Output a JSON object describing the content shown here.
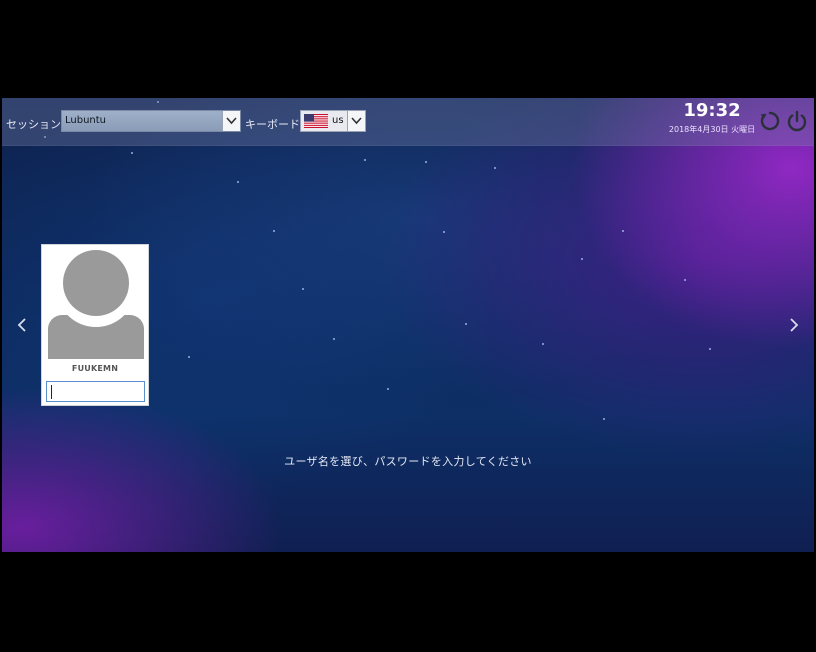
{
  "topbar": {
    "session_label": "セッション",
    "session_value": "Lubuntu",
    "keyboard_label": "キーボード",
    "keyboard_value": "us",
    "time": "19:32",
    "date": "2018年4月30日 火曜日"
  },
  "icons": {
    "session_dropdown": "chevron-down-icon",
    "keyboard_dropdown": "chevron-down-icon",
    "flag": "us-flag-icon",
    "reboot": "reboot-icon",
    "power": "power-icon",
    "prev": "chevron-left-icon",
    "next": "chevron-right-icon",
    "avatar": "user-silhouette-icon"
  },
  "user_card": {
    "username": "FUUKEMN",
    "password_value": ""
  },
  "prompt": "ユーザ名を選び、パスワードを入力してください",
  "colors": {
    "background_top": "#0f2350",
    "background_bottom": "#101f52",
    "accent_purple": "#9628c8",
    "focus_border": "#5b8fd1"
  }
}
